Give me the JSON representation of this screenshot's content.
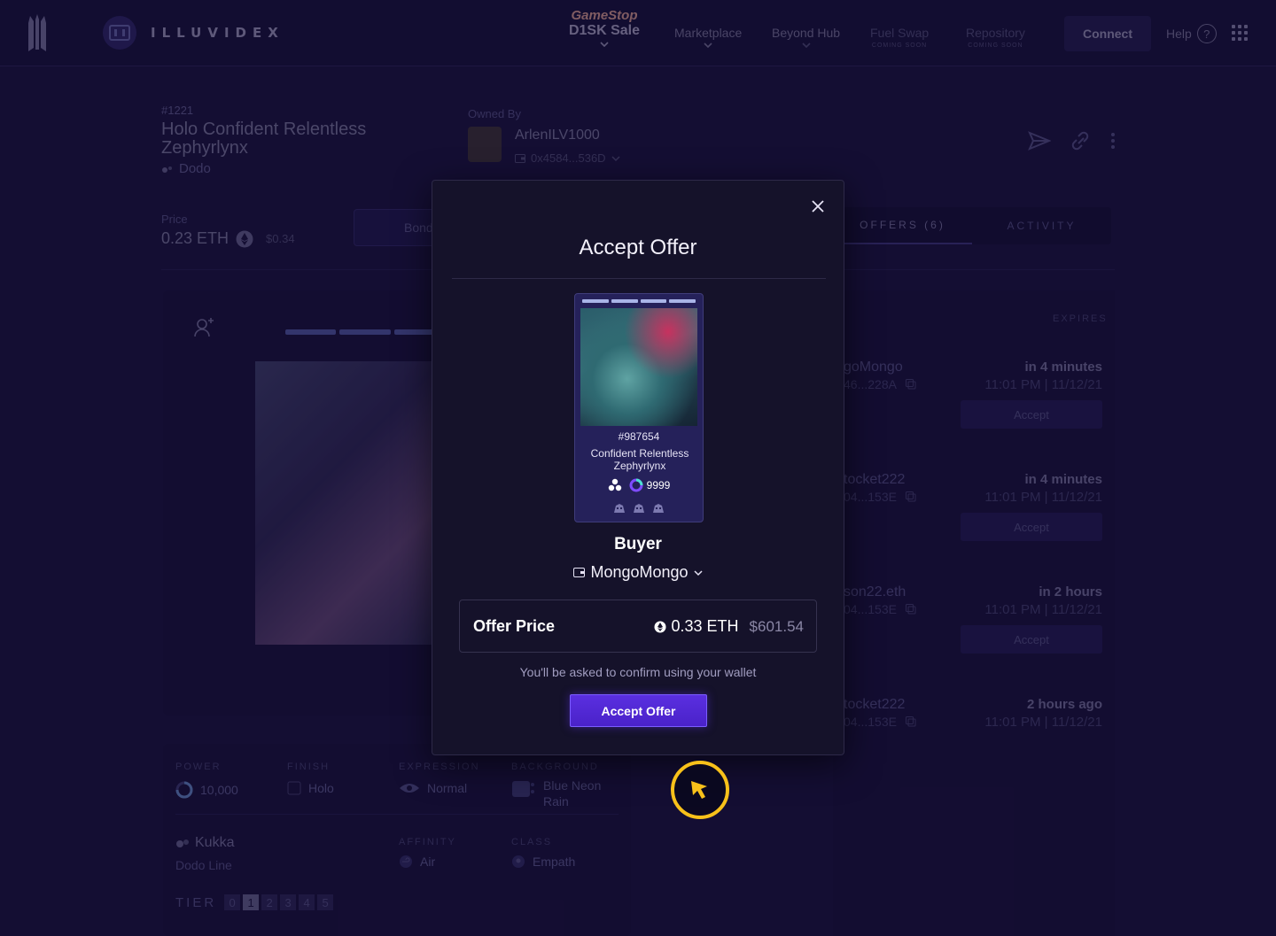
{
  "nav": {
    "brand_text": "ILLUVIDEX",
    "promo": {
      "line1": "GameStop",
      "line2": "D1SK Sale"
    },
    "items": [
      {
        "label": "Marketplace",
        "sub": ""
      },
      {
        "label": "Beyond Hub",
        "sub": ""
      },
      {
        "label": "Fuel Swap",
        "sub": "COMING SOON"
      },
      {
        "label": "Repository",
        "sub": "COMING SOON"
      }
    ],
    "connect_label": "Connect",
    "help_label": "Help"
  },
  "item": {
    "id": "#1221",
    "name": "Holo Confident Relentless Zephyrlynx",
    "line": "Dodo",
    "owned_by_label": "Owned By",
    "owner_name": "ArlenILV1000",
    "owner_addr": "0x4584...536D",
    "price_label": "Price",
    "price_eth": "0.23 ETH",
    "price_usd": "$0.34",
    "bond_label": "Bond"
  },
  "tabs": [
    {
      "label": "OFFERS (6)"
    },
    {
      "label": "ACTIVITY"
    }
  ],
  "attributes": {
    "power_label": "POWER",
    "power_value": "10,000",
    "finish_label": "FINISH",
    "finish_value": "Holo",
    "expression_label": "EXPRESSION",
    "expression_value": "Normal",
    "background_label": "BACKGROUND",
    "background_value": "Blue Neon Rain",
    "line_name": "Kukka",
    "line_sub": "Dodo Line",
    "affinity_label": "AFFINITY",
    "affinity_value": "Air",
    "class_label": "CLASS",
    "class_value": "Empath",
    "tier_label": "TIER",
    "tiers": [
      "0",
      "1",
      "2",
      "3",
      "4",
      "5"
    ],
    "selected_tier": "1"
  },
  "offers": {
    "expires_header": "EXPIRES",
    "rows": [
      {
        "who": "goMongo",
        "addr": "46...228A",
        "when": "in 4 minutes",
        "date": "11:01 PM | 11/12/21",
        "accept": "Accept"
      },
      {
        "who": "tocket222",
        "addr": "04...153E",
        "when": "in 4 minutes",
        "date": "11:01 PM | 11/12/21",
        "accept": "Accept"
      },
      {
        "who": "son22.eth",
        "addr": "04...153E",
        "when": "in 2 hours",
        "date": "11:01 PM | 11/12/21",
        "accept": "Accept"
      },
      {
        "who": "tocket222",
        "addr": "04...153E",
        "when": "2 hours ago",
        "date": "11:01 PM | 11/12/21",
        "accept": ""
      }
    ]
  },
  "modal": {
    "title": "Accept Offer",
    "card": {
      "id": "#987654",
      "name": "Confident Relentless Zephyrlynx",
      "power": "9999"
    },
    "buyer_label": "Buyer",
    "buyer_name": "MongoMongo",
    "offer_label": "Offer Price",
    "offer_eth": "0.33 ETH",
    "offer_usd": "$601.54",
    "confirm_note": "You'll be asked to confirm using your wallet",
    "accept_label": "Accept Offer"
  },
  "colors": {
    "accent": "#5a2fe0",
    "cursor_highlight": "#f8c11a",
    "background": "#1b1342"
  }
}
